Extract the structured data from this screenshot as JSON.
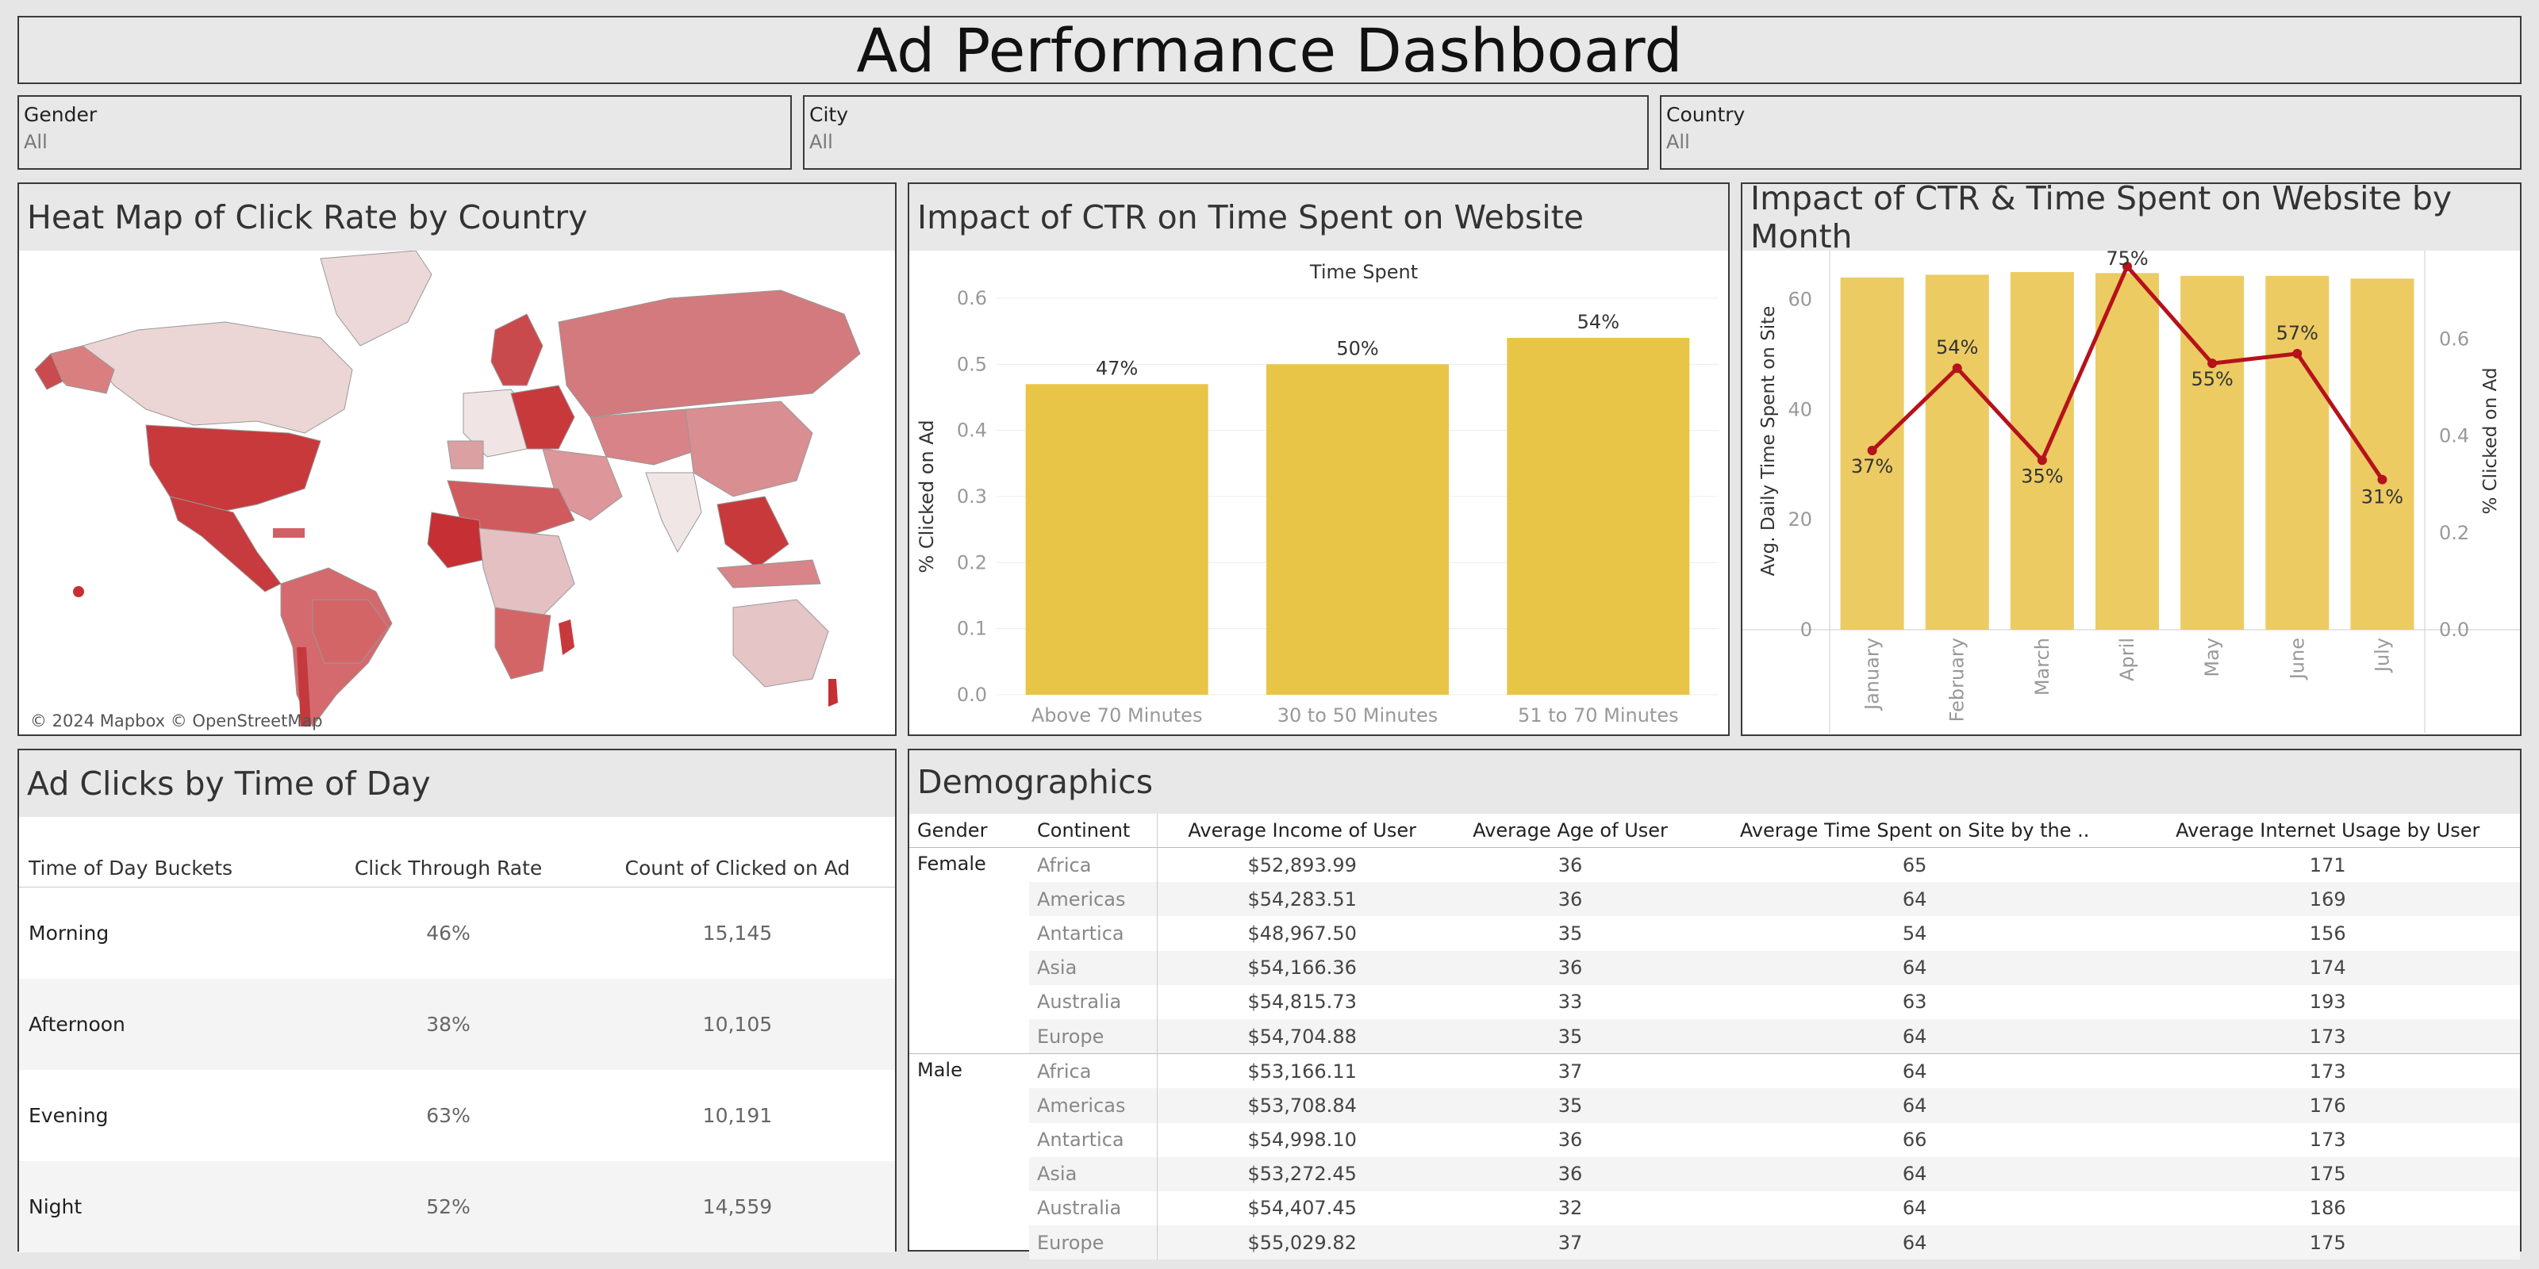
{
  "dashboard": {
    "title": "Ad Performance Dashboard"
  },
  "filters": [
    {
      "label": "Gender",
      "value": "All"
    },
    {
      "label": "City",
      "value": "All"
    },
    {
      "label": "Country",
      "value": "All"
    }
  ],
  "map_panel": {
    "title": "Heat Map of Click Rate by Country",
    "credit": "© 2024 Mapbox © OpenStreetMap"
  },
  "ctr_panel": {
    "title": "Impact of CTR on Time Spent on Website",
    "chart_data": {
      "type": "bar",
      "title": "Time Spent",
      "ylabel": "% Clicked on Ad",
      "categories": [
        "Above 70 Minutes",
        "30 to 50 Minutes",
        "51 to 70 Minutes"
      ],
      "values": [
        0.47,
        0.5,
        0.54
      ],
      "data_labels": [
        "47%",
        "50%",
        "54%"
      ],
      "ylim": [
        0,
        0.6
      ],
      "yticks": [
        "0.0",
        "0.1",
        "0.2",
        "0.3",
        "0.4",
        "0.5",
        "0.6"
      ],
      "color": "#e8c547"
    }
  },
  "month_panel": {
    "title": "Impact of CTR & Time Spent on Website by Month",
    "chart_data": {
      "type": "bar",
      "categories": [
        "January",
        "February",
        "March",
        "April",
        "May",
        "June",
        "July"
      ],
      "series": [
        {
          "values": [
            64,
            64.5,
            65,
            64.8,
            64.3,
            64.3,
            63.8
          ],
          "type": "bar"
        },
        {
          "values": [
            0.37,
            0.54,
            0.35,
            0.75,
            0.55,
            0.57,
            0.31
          ],
          "type": "line"
        }
      ],
      "line_labels": [
        "37%",
        "54%",
        "35%",
        "75%",
        "55%",
        "57%",
        "31%"
      ],
      "ylabel_left": "Avg. Daily Time Spent on Site",
      "ylabel_right": "% Clicked on Ad",
      "ylim_left": [
        0,
        66
      ],
      "ylim_right": [
        0,
        0.75
      ],
      "yticks_left": [
        "0",
        "20",
        "40",
        "60"
      ],
      "yticks_right": [
        "0.0",
        "0.2",
        "0.4",
        "0.6"
      ],
      "bar_color": "#eccb63",
      "line_color": "#b5121b"
    }
  },
  "tod_panel": {
    "title": "Ad Clicks by Time of Day",
    "headers": [
      "Time of Day Buckets",
      "Click Through Rate",
      "Count of Clicked on Ad"
    ],
    "rows": [
      [
        "Morning",
        "46%",
        "15,145"
      ],
      [
        "Afternoon",
        "38%",
        "10,105"
      ],
      [
        "Evening",
        "63%",
        "10,191"
      ],
      [
        "Night",
        "52%",
        "14,559"
      ]
    ]
  },
  "demo_panel": {
    "title": "Demographics",
    "headers": [
      "Gender",
      "Continent",
      "Average Income of User",
      "Average Age of User",
      "Average Time Spent on Site by the ..",
      "Average Internet Usage by User"
    ],
    "groups": [
      {
        "gender": "Female",
        "rows": [
          [
            "Africa",
            "$52,893.99",
            "36",
            "65",
            "171"
          ],
          [
            "Americas",
            "$54,283.51",
            "36",
            "64",
            "169"
          ],
          [
            "Antartica",
            "$48,967.50",
            "35",
            "54",
            "156"
          ],
          [
            "Asia",
            "$54,166.36",
            "36",
            "64",
            "174"
          ],
          [
            "Australia",
            "$54,815.73",
            "33",
            "63",
            "193"
          ],
          [
            "Europe",
            "$54,704.88",
            "35",
            "64",
            "173"
          ]
        ]
      },
      {
        "gender": "Male",
        "rows": [
          [
            "Africa",
            "$53,166.11",
            "37",
            "64",
            "173"
          ],
          [
            "Americas",
            "$53,708.84",
            "35",
            "64",
            "176"
          ],
          [
            "Antartica",
            "$54,998.10",
            "36",
            "66",
            "173"
          ],
          [
            "Asia",
            "$53,272.45",
            "36",
            "64",
            "175"
          ],
          [
            "Australia",
            "$54,407.45",
            "32",
            "64",
            "186"
          ],
          [
            "Europe",
            "$55,029.82",
            "37",
            "64",
            "175"
          ]
        ]
      }
    ]
  }
}
